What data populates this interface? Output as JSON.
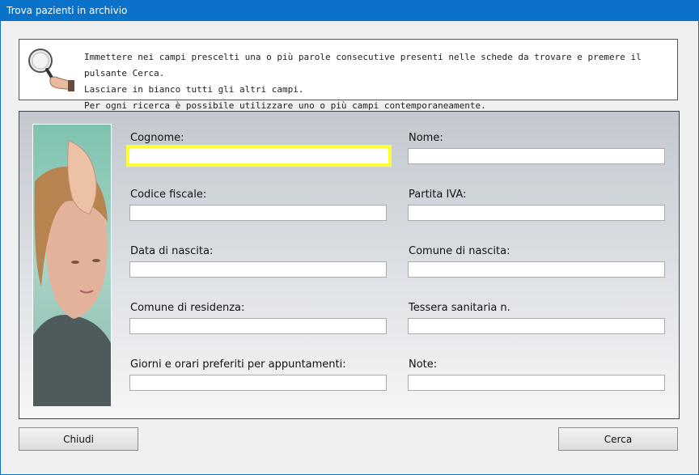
{
  "window": {
    "title": "Trova pazienti in archivio"
  },
  "info": {
    "line1": "Immettere nei campi prescelti una o più parole consecutive presenti nelle schede da trovare e premere il pulsante Cerca.",
    "line2": "Lasciare in bianco tutti gli altri campi.",
    "line3": "Per ogni ricerca è possibile utilizzare uno o più campi contemporaneamente.",
    "icon": "magnifier-icon"
  },
  "fields": {
    "cognome": {
      "label": "Cognome:",
      "value": ""
    },
    "nome": {
      "label": "Nome:",
      "value": ""
    },
    "codice_fiscale": {
      "label": "Codice fiscale:",
      "value": ""
    },
    "partita_iva": {
      "label": "Partita IVA:",
      "value": ""
    },
    "data_nascita": {
      "label": "Data di nascita:",
      "value": ""
    },
    "comune_nascita": {
      "label": "Comune di nascita:",
      "value": ""
    },
    "comune_residenza": {
      "label": "Comune di residenza:",
      "value": ""
    },
    "tessera_sanitaria": {
      "label": "Tessera sanitaria n.",
      "value": ""
    },
    "giorni_orari": {
      "label": "Giorni e orari preferiti per appuntamenti:",
      "value": ""
    },
    "note": {
      "label": "Note:",
      "value": ""
    }
  },
  "buttons": {
    "close": "Chiudi",
    "search": "Cerca"
  },
  "colors": {
    "titlebar": "#0a72c8",
    "focus_border": "#ffff33"
  }
}
